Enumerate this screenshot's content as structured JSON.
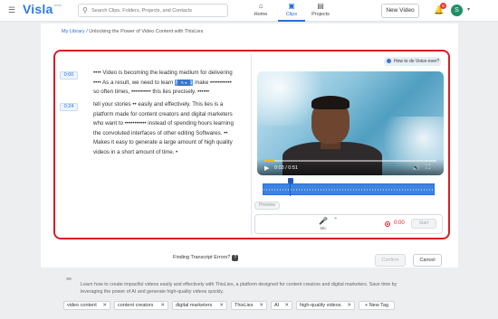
{
  "app": {
    "logo": "Visla",
    "logo_sub": "beta",
    "search_placeholder": "Search Clips, Folders, Projects, and Contacts",
    "nav": [
      {
        "label": "Home",
        "icon": "home-icon"
      },
      {
        "label": "Clips",
        "icon": "clips-icon"
      },
      {
        "label": "Projects",
        "icon": "projects-icon"
      }
    ],
    "active_nav": "Clips",
    "new_video_label": "New Video",
    "notification_count": "9",
    "avatar_initial": "S"
  },
  "breadcrumb": {
    "root": "My Library",
    "separator": "/",
    "current": "Unlocking the Power of Video Content with ThisLies"
  },
  "transcript": {
    "segments": [
      {
        "time": "0:00",
        "text_before": "•••• Video is becoming the leading medium for delivering •••• As a result, we need to learn ",
        "highlight": "how to",
        "text_after": " make ••••••••••• so often times, •••••••••• this lies precisely. ••••••"
      },
      {
        "time": "0:24",
        "text": "tell your stories •• easily and effectively. This lies is a platform made for content creators and digital marketers who want to ••••••••••• instead of spending hours learning the convoluted interfaces of other editing Softwares. •• Makes it easy to generate a large amount of high quality videos in a short amount of time. •"
      }
    ]
  },
  "voiceover": {
    "how_to_label": "How to do Voice-over?",
    "video_time": "0:03 / 0:51",
    "video_progress": 0.06,
    "playhead_progress": 0.16,
    "preview_label": "Preview",
    "mic_label": "Mic",
    "record_time": "0:00",
    "start_label": "Start"
  },
  "footer": {
    "finding_errors": "Finding Transcript Errors?",
    "help_badge": "?",
    "confirm_label": "Confirm",
    "cancel_label": "Cancel"
  },
  "description": "Learn how to create impactful videos easily and effectively with ThisLies, a platform designed for content creators and digital marketers. Save time by leveraging the power of AI and generate high-quality videos quickly.",
  "tags": [
    "video content",
    "content creators",
    "digital marketers",
    "ThisLies",
    "AI",
    "high-quality videos."
  ],
  "new_tag_label": "+ New Tag",
  "colors": {
    "accent": "#2a6fdb",
    "highlight_border": "#d71c24",
    "avatar": "#1f8f66"
  }
}
